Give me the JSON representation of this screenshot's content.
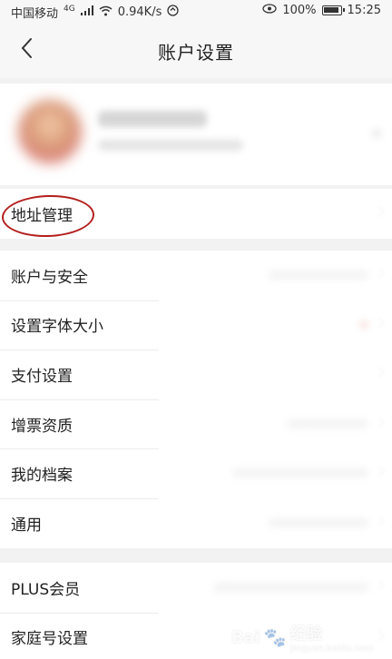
{
  "status_bar": {
    "carrier": "中国移动",
    "signal": "4G",
    "speed": "0.94K/s",
    "battery": "100%",
    "time": "15:25"
  },
  "header": {
    "title": "账户设置"
  },
  "groups": [
    [
      {
        "label": "地址管理",
        "key": "address"
      }
    ],
    [
      {
        "label": "账户与安全",
        "key": "account-security"
      },
      {
        "label": "设置字体大小",
        "key": "font-size"
      },
      {
        "label": "支付设置",
        "key": "payment"
      },
      {
        "label": "增票资质",
        "key": "vat-invoice"
      },
      {
        "label": "我的档案",
        "key": "my-profile"
      },
      {
        "label": "通用",
        "key": "general"
      }
    ],
    [
      {
        "label": "PLUS会员",
        "key": "plus-member"
      },
      {
        "label": "家庭号设置",
        "key": "family-account"
      }
    ]
  ],
  "watermark": {
    "brand": "Bai",
    "brand_suffix": "经验",
    "sub": "jingyan.baidu.com"
  },
  "colors": {
    "highlight": "#b3201e",
    "background": "#f2f2f2"
  }
}
